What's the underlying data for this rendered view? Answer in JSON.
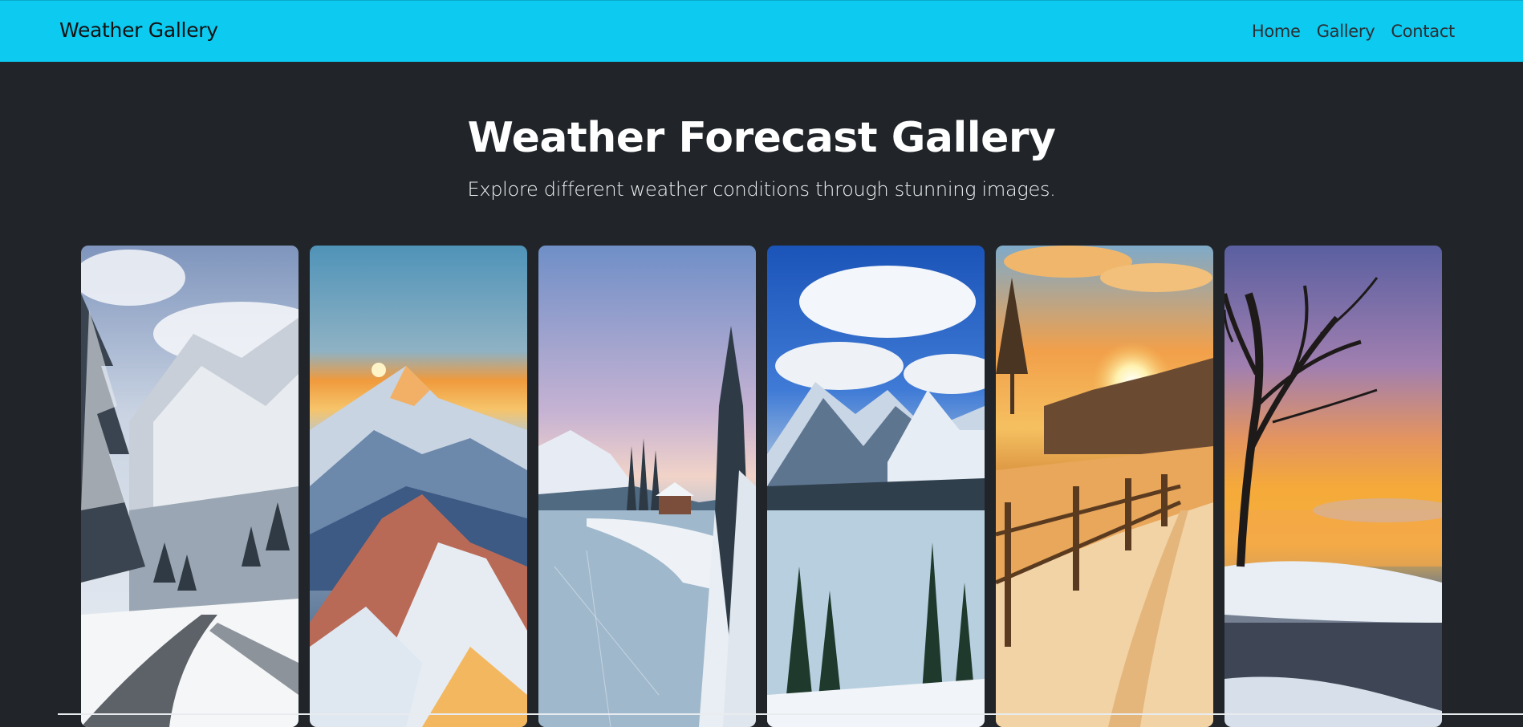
{
  "navbar": {
    "brand": "Weather Gallery",
    "links": [
      "Home",
      "Gallery",
      "Contact"
    ],
    "color": "#0dcaf0"
  },
  "hero": {
    "title": "Weather Forecast Gallery",
    "subtitle": "Explore different weather conditions through stunning images."
  },
  "gallery": {
    "images": [
      {
        "name": "snowy-mountain-road"
      },
      {
        "name": "sunrise-snowy-peaks"
      },
      {
        "name": "frozen-lake-cabin"
      },
      {
        "name": "frozen-lake-blue-sky"
      },
      {
        "name": "sunset-snowy-fence"
      },
      {
        "name": "tree-silhouette-sunset"
      }
    ]
  },
  "colors": {
    "background": "#212529",
    "text": "#ffffff"
  }
}
